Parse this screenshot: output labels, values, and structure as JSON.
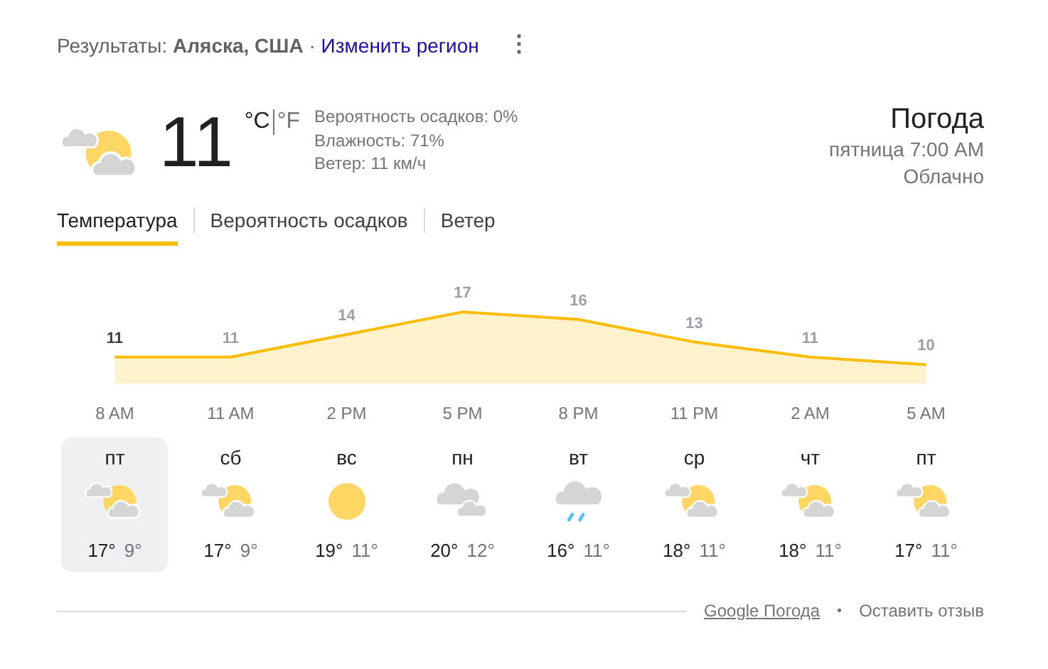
{
  "header": {
    "results": "Результаты: **Аляска, США** · ",
    "change_region": "Изменить регион",
    "more": "⋮"
  },
  "current": {
    "kind": "partly_cloudy",
    "temperature": "11",
    "units": [
      {
        "label": "°C",
        "selected": true
      },
      {
        "label": "°F",
        "selected": false
      }
    ],
    "details": [
      "Вероятность осадков: 0%",
      "Влажность: 71%",
      "Ветер: 11 км/ч"
    ],
    "title": "Погода",
    "time": "пятница 7:00 AM",
    "condition": "Облачно"
  },
  "tabs": [
    {
      "label": "Температура",
      "selected": true
    },
    {
      "label": "Вероятность осадков",
      "selected": false
    },
    {
      "label": "Ветер",
      "selected": false
    }
  ],
  "chart": {
    "chart_data": {
      "type": "area",
      "categories": [
        "8 AM",
        "11 AM",
        "2 PM",
        "5 PM",
        "8 PM",
        "11 PM",
        "2 AM",
        "5 AM"
      ],
      "series": [
        {
          "color": "#fbbc04",
          "values": [
            11,
            11,
            14,
            17,
            16,
            13,
            11,
            10
          ]
        }
      ],
      "data_labels": true
    }
  },
  "days": [
    {
      "day": "пт",
      "kind": "partly_cloudy",
      "high": "17°",
      "low": "9°",
      "selected": true
    },
    {
      "day": "сб",
      "kind": "partly_cloudy",
      "high": "17°",
      "low": "9°",
      "selected": false
    },
    {
      "day": "вс",
      "kind": "sunny",
      "high": "19°",
      "low": "11°",
      "selected": false
    },
    {
      "day": "пн",
      "kind": "cloudy",
      "high": "20°",
      "low": "12°",
      "selected": false
    },
    {
      "day": "вт",
      "kind": "rain",
      "high": "16°",
      "low": "11°",
      "selected": false
    },
    {
      "day": "ср",
      "kind": "partly_cloudy",
      "high": "18°",
      "low": "11°",
      "selected": false
    },
    {
      "day": "чт",
      "kind": "partly_cloudy",
      "high": "18°",
      "low": "11°",
      "selected": false
    },
    {
      "day": "пт",
      "kind": "partly_cloudy",
      "high": "17°",
      "low": "11°",
      "selected": false
    }
  ],
  "footer": {
    "source": "Google Погода",
    "separator": "•",
    "feedback": "Оставить отзыв"
  }
}
